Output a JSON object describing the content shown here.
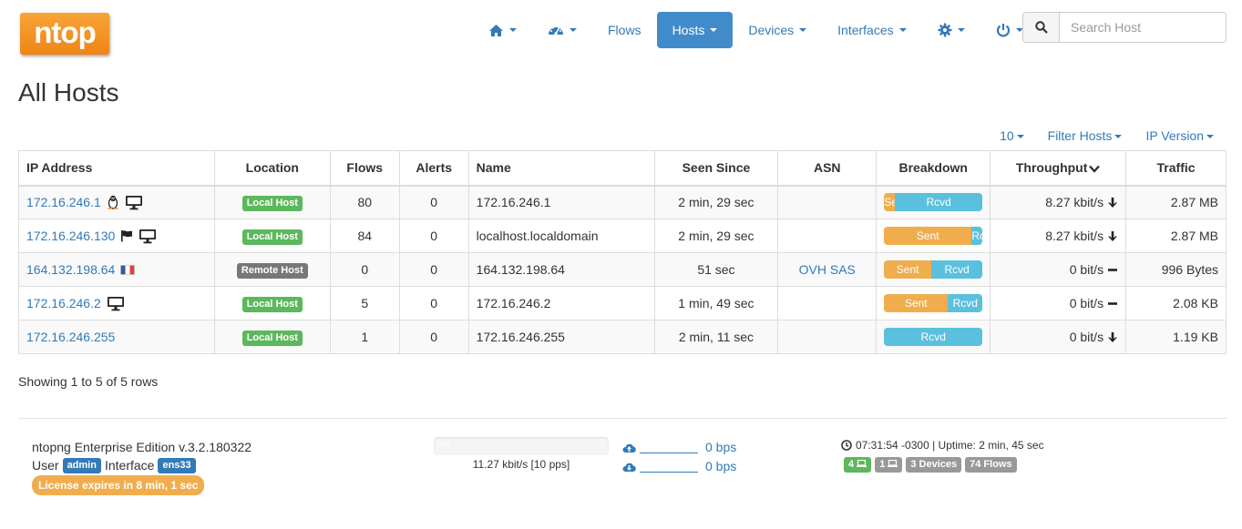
{
  "logo": {
    "text": "ntop"
  },
  "nav": {
    "flows_label": "Flows",
    "hosts_label": "Hosts",
    "devices_label": "Devices",
    "interfaces_label": "Interfaces",
    "active": "Hosts"
  },
  "search": {
    "placeholder": "Search Host"
  },
  "page": {
    "title": "All Hosts"
  },
  "toolbar": {
    "per_page": "10",
    "filter_label": "Filter Hosts",
    "ip_version_label": "IP Version"
  },
  "table": {
    "headers": [
      "IP Address",
      "Location",
      "Flows",
      "Alerts",
      "Name",
      "Seen Since",
      "ASN",
      "Breakdown",
      "Throughput",
      "Traffic"
    ],
    "rows": [
      {
        "ip": "172.16.246.1",
        "icons": [
          "linux-icon",
          "monitor-icon"
        ],
        "location": "Local Host",
        "location_type": "local",
        "flows": "80",
        "alerts": "0",
        "name": "172.16.246.1",
        "seen": "2 min, 29 sec",
        "asn": "",
        "sent_label": "Se",
        "rcvd_label": "Rcvd",
        "sent_pct": 11,
        "throughput": "8.27 kbit/s",
        "trend": "down",
        "traffic": "2.87 MB"
      },
      {
        "ip": "172.16.246.130",
        "icons": [
          "flag-icon",
          "monitor-icon"
        ],
        "location": "Local Host",
        "location_type": "local",
        "flows": "84",
        "alerts": "0",
        "name": "localhost.localdomain",
        "seen": "2 min, 29 sec",
        "asn": "",
        "sent_label": "Sent",
        "rcvd_label": "Rc",
        "sent_pct": 89,
        "throughput": "8.27 kbit/s",
        "trend": "down",
        "traffic": "2.87 MB"
      },
      {
        "ip": "164.132.198.64",
        "icons": [
          "france-flag-icon"
        ],
        "location": "Remote Host",
        "location_type": "remote",
        "flows": "0",
        "alerts": "0",
        "name": "164.132.198.64",
        "seen": "51 sec",
        "asn": "OVH SAS",
        "sent_label": "Sent",
        "rcvd_label": "Rcvd",
        "sent_pct": 48,
        "throughput": "0 bit/s",
        "trend": "flat",
        "traffic": "996 Bytes"
      },
      {
        "ip": "172.16.246.2",
        "icons": [
          "monitor-icon"
        ],
        "location": "Local Host",
        "location_type": "local",
        "flows": "5",
        "alerts": "0",
        "name": "172.16.246.2",
        "seen": "1 min, 49 sec",
        "asn": "",
        "sent_label": "Sent",
        "rcvd_label": "Rcvd",
        "sent_pct": 65,
        "throughput": "0 bit/s",
        "trend": "flat",
        "traffic": "2.08 KB"
      },
      {
        "ip": "172.16.246.255",
        "icons": [],
        "location": "Local Host",
        "location_type": "local",
        "flows": "1",
        "alerts": "0",
        "name": "172.16.246.255",
        "seen": "2 min, 11 sec",
        "asn": "",
        "sent_label": "",
        "rcvd_label": "Rcvd",
        "sent_pct": 0,
        "throughput": "0 bit/s",
        "trend": "down",
        "traffic": "1.19 KB"
      }
    ]
  },
  "pagination": {
    "showing": "Showing 1 to 5 of 5 rows"
  },
  "footer": {
    "edition": "ntopng Enterprise Edition v.3.2.180322",
    "user_label": "User",
    "user": "admin",
    "interface_label": "Interface",
    "interface": "ens33",
    "license": "License expires in 8 min, 1 sec",
    "bw_pct_label": "0%",
    "bw_text": "11.27 kbit/s [10 pps]",
    "upload_bps": "0 bps",
    "download_bps": "0 bps",
    "clock": "07:31:54 -0300 | Uptime: 2 min, 45 sec",
    "local_hosts": "4",
    "remote_hosts": "1",
    "devices": "3 Devices",
    "flows": "74 Flows"
  },
  "colors": {
    "accent": "#337ab7",
    "active_nav": "#428bca",
    "logo": "#f08a1c",
    "local_host": "#5cb85c",
    "remote_host": "#777777",
    "sent": "#f0ad4e",
    "rcvd": "#5bc0de"
  }
}
